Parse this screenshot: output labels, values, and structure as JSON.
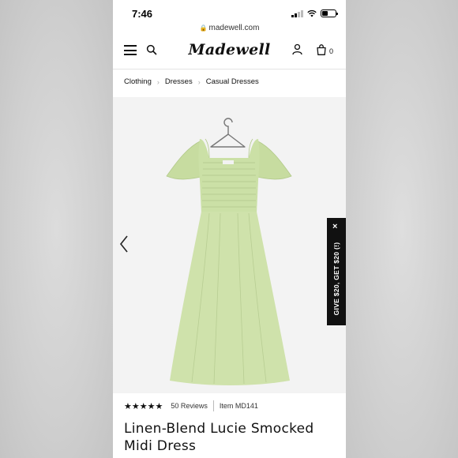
{
  "status_bar": {
    "time": "7:46"
  },
  "browser": {
    "url": "madewell.com"
  },
  "header": {
    "logo": "Madewell",
    "cart_count": "0",
    "icons": [
      "menu-icon",
      "search-icon",
      "account-icon",
      "bag-icon"
    ]
  },
  "breadcrumb": [
    "Clothing",
    "Dresses",
    "Casual Dresses"
  ],
  "promo": {
    "text": "GIVE $20, GET $20 (!)",
    "close": "×"
  },
  "product": {
    "rating_stars": 5,
    "stars_text": "★★★★★",
    "reviews": "50 Reviews",
    "item_number": "Item MD141",
    "title": "Linen-Blend Lucie Smocked Midi Dress",
    "color": "#cfe2ab"
  },
  "colors": {
    "background": "#ffffff",
    "image_bg": "#f3f3f3",
    "text": "#111111"
  }
}
